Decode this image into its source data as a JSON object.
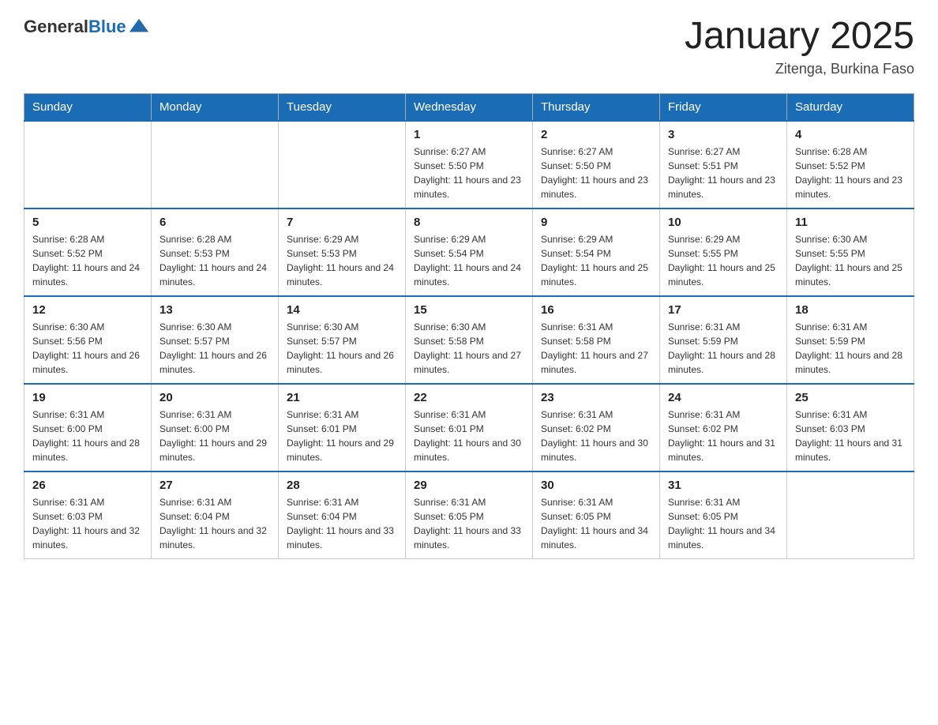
{
  "header": {
    "logo_text_black": "General",
    "logo_text_blue": "Blue",
    "month_year": "January 2025",
    "location": "Zitenga, Burkina Faso"
  },
  "days_of_week": [
    "Sunday",
    "Monday",
    "Tuesday",
    "Wednesday",
    "Thursday",
    "Friday",
    "Saturday"
  ],
  "weeks": [
    [
      {
        "day": "",
        "info": ""
      },
      {
        "day": "",
        "info": ""
      },
      {
        "day": "",
        "info": ""
      },
      {
        "day": "1",
        "info": "Sunrise: 6:27 AM\nSunset: 5:50 PM\nDaylight: 11 hours and 23 minutes."
      },
      {
        "day": "2",
        "info": "Sunrise: 6:27 AM\nSunset: 5:50 PM\nDaylight: 11 hours and 23 minutes."
      },
      {
        "day": "3",
        "info": "Sunrise: 6:27 AM\nSunset: 5:51 PM\nDaylight: 11 hours and 23 minutes."
      },
      {
        "day": "4",
        "info": "Sunrise: 6:28 AM\nSunset: 5:52 PM\nDaylight: 11 hours and 23 minutes."
      }
    ],
    [
      {
        "day": "5",
        "info": "Sunrise: 6:28 AM\nSunset: 5:52 PM\nDaylight: 11 hours and 24 minutes."
      },
      {
        "day": "6",
        "info": "Sunrise: 6:28 AM\nSunset: 5:53 PM\nDaylight: 11 hours and 24 minutes."
      },
      {
        "day": "7",
        "info": "Sunrise: 6:29 AM\nSunset: 5:53 PM\nDaylight: 11 hours and 24 minutes."
      },
      {
        "day": "8",
        "info": "Sunrise: 6:29 AM\nSunset: 5:54 PM\nDaylight: 11 hours and 24 minutes."
      },
      {
        "day": "9",
        "info": "Sunrise: 6:29 AM\nSunset: 5:54 PM\nDaylight: 11 hours and 25 minutes."
      },
      {
        "day": "10",
        "info": "Sunrise: 6:29 AM\nSunset: 5:55 PM\nDaylight: 11 hours and 25 minutes."
      },
      {
        "day": "11",
        "info": "Sunrise: 6:30 AM\nSunset: 5:55 PM\nDaylight: 11 hours and 25 minutes."
      }
    ],
    [
      {
        "day": "12",
        "info": "Sunrise: 6:30 AM\nSunset: 5:56 PM\nDaylight: 11 hours and 26 minutes."
      },
      {
        "day": "13",
        "info": "Sunrise: 6:30 AM\nSunset: 5:57 PM\nDaylight: 11 hours and 26 minutes."
      },
      {
        "day": "14",
        "info": "Sunrise: 6:30 AM\nSunset: 5:57 PM\nDaylight: 11 hours and 26 minutes."
      },
      {
        "day": "15",
        "info": "Sunrise: 6:30 AM\nSunset: 5:58 PM\nDaylight: 11 hours and 27 minutes."
      },
      {
        "day": "16",
        "info": "Sunrise: 6:31 AM\nSunset: 5:58 PM\nDaylight: 11 hours and 27 minutes."
      },
      {
        "day": "17",
        "info": "Sunrise: 6:31 AM\nSunset: 5:59 PM\nDaylight: 11 hours and 28 minutes."
      },
      {
        "day": "18",
        "info": "Sunrise: 6:31 AM\nSunset: 5:59 PM\nDaylight: 11 hours and 28 minutes."
      }
    ],
    [
      {
        "day": "19",
        "info": "Sunrise: 6:31 AM\nSunset: 6:00 PM\nDaylight: 11 hours and 28 minutes."
      },
      {
        "day": "20",
        "info": "Sunrise: 6:31 AM\nSunset: 6:00 PM\nDaylight: 11 hours and 29 minutes."
      },
      {
        "day": "21",
        "info": "Sunrise: 6:31 AM\nSunset: 6:01 PM\nDaylight: 11 hours and 29 minutes."
      },
      {
        "day": "22",
        "info": "Sunrise: 6:31 AM\nSunset: 6:01 PM\nDaylight: 11 hours and 30 minutes."
      },
      {
        "day": "23",
        "info": "Sunrise: 6:31 AM\nSunset: 6:02 PM\nDaylight: 11 hours and 30 minutes."
      },
      {
        "day": "24",
        "info": "Sunrise: 6:31 AM\nSunset: 6:02 PM\nDaylight: 11 hours and 31 minutes."
      },
      {
        "day": "25",
        "info": "Sunrise: 6:31 AM\nSunset: 6:03 PM\nDaylight: 11 hours and 31 minutes."
      }
    ],
    [
      {
        "day": "26",
        "info": "Sunrise: 6:31 AM\nSunset: 6:03 PM\nDaylight: 11 hours and 32 minutes."
      },
      {
        "day": "27",
        "info": "Sunrise: 6:31 AM\nSunset: 6:04 PM\nDaylight: 11 hours and 32 minutes."
      },
      {
        "day": "28",
        "info": "Sunrise: 6:31 AM\nSunset: 6:04 PM\nDaylight: 11 hours and 33 minutes."
      },
      {
        "day": "29",
        "info": "Sunrise: 6:31 AM\nSunset: 6:05 PM\nDaylight: 11 hours and 33 minutes."
      },
      {
        "day": "30",
        "info": "Sunrise: 6:31 AM\nSunset: 6:05 PM\nDaylight: 11 hours and 34 minutes."
      },
      {
        "day": "31",
        "info": "Sunrise: 6:31 AM\nSunset: 6:05 PM\nDaylight: 11 hours and 34 minutes."
      },
      {
        "day": "",
        "info": ""
      }
    ]
  ]
}
